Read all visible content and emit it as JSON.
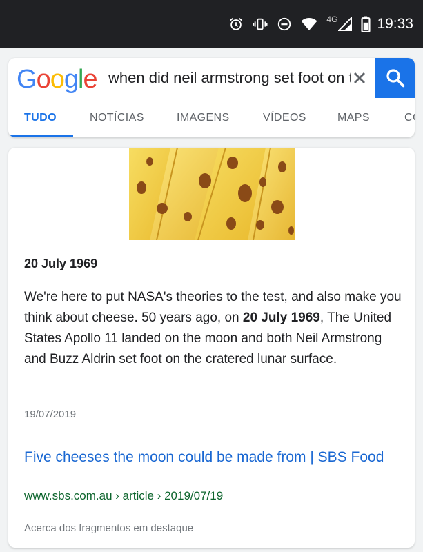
{
  "status_bar": {
    "network": "4G",
    "time": "19:33"
  },
  "search": {
    "logo": [
      "G",
      "o",
      "o",
      "g",
      "l",
      "e"
    ],
    "query": "when did neil armstrong set foot on the moon"
  },
  "tabs": [
    "TUDO",
    "NOTÍCIAS",
    "IMAGENS",
    "VÍDEOS",
    "MAPS",
    "COMPRAS"
  ],
  "result": {
    "answer": "20 July 1969",
    "snippet_part1": "We're here to put NASA's theories to the test, and also make you think about cheese. 50 years ago, on ",
    "snippet_bold": "20 July 1969",
    "snippet_part2": ", The United States Apollo 11 landed on the moon and both Neil Armstrong and Buzz Aldrin set foot on the cratered lunar surface.",
    "date": "19/07/2019",
    "title": "Five cheeses the moon could be made from | SBS Food",
    "url": "www.sbs.com.au › article › 2019/07/19",
    "about": "Acerca dos fragmentos em destaque"
  },
  "colors": {
    "accent": "#1a73e8",
    "status_bar": "#202124",
    "link": "#1967d2",
    "url_green": "#0d652d"
  }
}
